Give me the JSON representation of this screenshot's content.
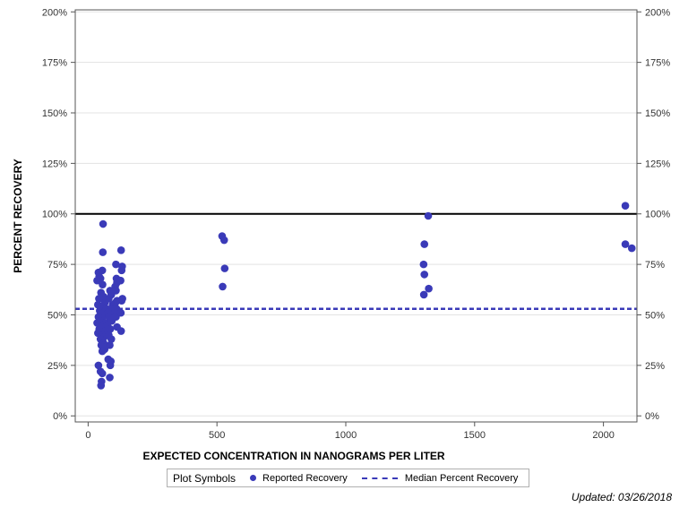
{
  "chart_data": {
    "type": "scatter",
    "xlabel": "EXPECTED CONCENTRATION IN NANOGRAMS PER LITER",
    "ylabel": "PERCENT RECOVERY",
    "xlim": [
      -50,
      2130
    ],
    "ylim": [
      -3,
      201
    ],
    "xticks": [
      0,
      500,
      1000,
      1500,
      2000
    ],
    "xtick_labels": [
      "0",
      "500",
      "1000",
      "1500",
      "2000"
    ],
    "yticks": [
      0,
      25,
      50,
      75,
      100,
      125,
      150,
      175,
      200
    ],
    "ytick_labels": [
      "0%",
      "25%",
      "50%",
      "75%",
      "100%",
      "125%",
      "150%",
      "175%",
      "200%"
    ],
    "grid": true,
    "series": [
      {
        "name": "Reported Recovery",
        "color": "#3a3ab8",
        "points": [
          [
            58,
            95
          ],
          [
            57,
            81
          ],
          [
            40,
            71
          ],
          [
            55,
            72
          ],
          [
            43,
            69
          ],
          [
            48,
            68
          ],
          [
            35,
            67
          ],
          [
            56,
            65
          ],
          [
            50,
            61
          ],
          [
            60,
            59
          ],
          [
            42,
            58
          ],
          [
            65,
            56
          ],
          [
            38,
            55
          ],
          [
            52,
            54
          ],
          [
            70,
            53
          ],
          [
            45,
            52
          ],
          [
            58,
            51
          ],
          [
            63,
            50
          ],
          [
            40,
            49
          ],
          [
            55,
            48
          ],
          [
            47,
            47
          ],
          [
            68,
            46
          ],
          [
            35,
            46
          ],
          [
            60,
            45
          ],
          [
            50,
            44
          ],
          [
            43,
            43
          ],
          [
            66,
            42
          ],
          [
            38,
            41
          ],
          [
            56,
            40
          ],
          [
            62,
            39
          ],
          [
            48,
            38
          ],
          [
            54,
            37
          ],
          [
            60,
            36
          ],
          [
            51,
            35
          ],
          [
            57,
            34
          ],
          [
            64,
            33
          ],
          [
            55,
            32
          ],
          [
            40,
            25
          ],
          [
            48,
            22
          ],
          [
            55,
            21
          ],
          [
            52,
            17
          ],
          [
            50,
            15
          ],
          [
            85,
            62
          ],
          [
            90,
            60
          ],
          [
            80,
            58
          ],
          [
            95,
            55
          ],
          [
            88,
            53
          ],
          [
            78,
            51
          ],
          [
            82,
            49
          ],
          [
            92,
            47
          ],
          [
            75,
            45
          ],
          [
            86,
            43
          ],
          [
            80,
            40
          ],
          [
            90,
            38
          ],
          [
            84,
            35
          ],
          [
            78,
            28
          ],
          [
            86,
            25
          ],
          [
            88,
            27
          ],
          [
            84,
            19
          ],
          [
            108,
            75
          ],
          [
            110,
            68
          ],
          [
            112,
            66
          ],
          [
            105,
            64
          ],
          [
            108,
            62
          ],
          [
            112,
            57
          ],
          [
            106,
            56
          ],
          [
            110,
            53
          ],
          [
            104,
            51
          ],
          [
            108,
            49
          ],
          [
            112,
            44
          ],
          [
            128,
            82
          ],
          [
            132,
            74
          ],
          [
            130,
            72
          ],
          [
            126,
            67
          ],
          [
            133,
            58
          ],
          [
            130,
            57
          ],
          [
            127,
            51
          ],
          [
            128,
            42
          ],
          [
            520,
            89
          ],
          [
            528,
            87
          ],
          [
            530,
            73
          ],
          [
            522,
            64
          ],
          [
            1305,
            85
          ],
          [
            1302,
            75
          ],
          [
            1305,
            70
          ],
          [
            1320,
            99
          ],
          [
            1322,
            63
          ],
          [
            1303,
            60
          ],
          [
            2085,
            104
          ],
          [
            2085,
            85
          ],
          [
            2110,
            83
          ]
        ]
      }
    ],
    "reference_line": {
      "y": 100,
      "color": "#000000"
    },
    "median_line": {
      "name": "Median Percent Recovery",
      "y": 53,
      "color": "#3a3ab8",
      "style": "dashed"
    }
  },
  "legend": {
    "title": "Plot Symbols",
    "items": [
      "Reported Recovery",
      "Median Percent Recovery"
    ]
  },
  "footnote": "Updated: 03/26/2018"
}
